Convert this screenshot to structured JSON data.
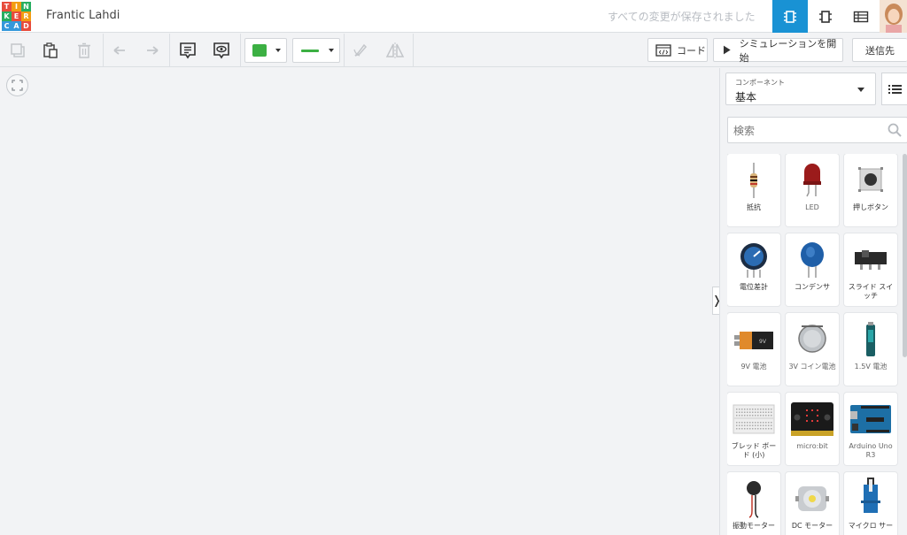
{
  "header": {
    "logo_letters": [
      "T",
      "I",
      "N",
      "K",
      "E",
      "R",
      "C",
      "A",
      "D"
    ],
    "logo_colors": [
      "#e74c3c",
      "#f39c12",
      "#27ae60",
      "#27ae60",
      "#e74c3c",
      "#f39c12",
      "#3498db",
      "#3498db",
      "#e74c3c"
    ],
    "project_name": "Frantic Lahdi",
    "save_status": "すべての変更が保存されました",
    "accent": "#1992d4"
  },
  "toolbar": {
    "icons": [
      "copy-icon",
      "paste-icon",
      "trash-icon",
      "undo-icon",
      "redo-icon",
      "note-icon",
      "visibility-icon",
      "color-dropdown",
      "wire-type-dropdown",
      "notes-icon",
      "flip-icon"
    ],
    "fill_color": "#3cb043",
    "wire_color": "#3cb043",
    "code_label": "コード",
    "simulate_label": "シミュレーションを開始",
    "send_label": "送信先"
  },
  "panel": {
    "components_label": "コンポーネント",
    "components_value": "基本",
    "search_placeholder": "検索",
    "items": [
      {
        "name": "抵抗"
      },
      {
        "name": "LED"
      },
      {
        "name": "押しボタン"
      },
      {
        "name": "電位差計"
      },
      {
        "name": "コンデンサ"
      },
      {
        "name": "スライド スイッチ"
      },
      {
        "name": "9V 電池"
      },
      {
        "name": "3V コイン電池"
      },
      {
        "name": "1.5V 電池"
      },
      {
        "name": "ブレッド ボード (小)"
      },
      {
        "name": "micro:bit"
      },
      {
        "name": "Arduino Uno R3"
      },
      {
        "name": "振動モーター"
      },
      {
        "name": "DC モーター"
      },
      {
        "name": "マイクロ サー"
      }
    ]
  }
}
